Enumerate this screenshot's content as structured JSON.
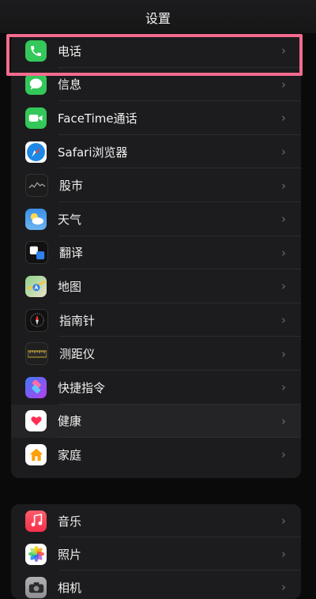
{
  "nav": {
    "title": "设置"
  },
  "group1": [
    {
      "label": "电话",
      "icon": "phone-icon",
      "color": "#34c759"
    },
    {
      "label": "信息",
      "icon": "messages-icon",
      "color": "#34c759"
    },
    {
      "label": "FaceTime通话",
      "icon": "facetime-icon",
      "color": "#34c759"
    },
    {
      "label": "Safari浏览器",
      "icon": "safari-icon",
      "color": "#1e88e5"
    },
    {
      "label": "股市",
      "icon": "stocks-icon",
      "color": "#1c1c1c"
    },
    {
      "label": "天气",
      "icon": "weather-icon",
      "color": "#3a8ee6"
    },
    {
      "label": "翻译",
      "icon": "translate-icon",
      "color": "#111111"
    },
    {
      "label": "地图",
      "icon": "maps-icon",
      "color": "#6fc26b"
    },
    {
      "label": "指南针",
      "icon": "compass-icon",
      "color": "#111111"
    },
    {
      "label": "测距仪",
      "icon": "measure-icon",
      "color": "#1f1f1f"
    },
    {
      "label": "快捷指令",
      "icon": "shortcuts-icon",
      "color": "#5b3df5"
    },
    {
      "label": "健康",
      "icon": "health-icon",
      "color": "#ffffff"
    },
    {
      "label": "家庭",
      "icon": "home-icon",
      "color": "#ffffff"
    }
  ],
  "group2": [
    {
      "label": "音乐",
      "icon": "music-icon",
      "color": "#fa3c52"
    },
    {
      "label": "照片",
      "icon": "photos-icon",
      "color": "#ffffff"
    },
    {
      "label": "相机",
      "icon": "camera-icon",
      "color": "#8e8e93"
    }
  ],
  "chevron": "›",
  "highlight_color": "#f36b8f"
}
